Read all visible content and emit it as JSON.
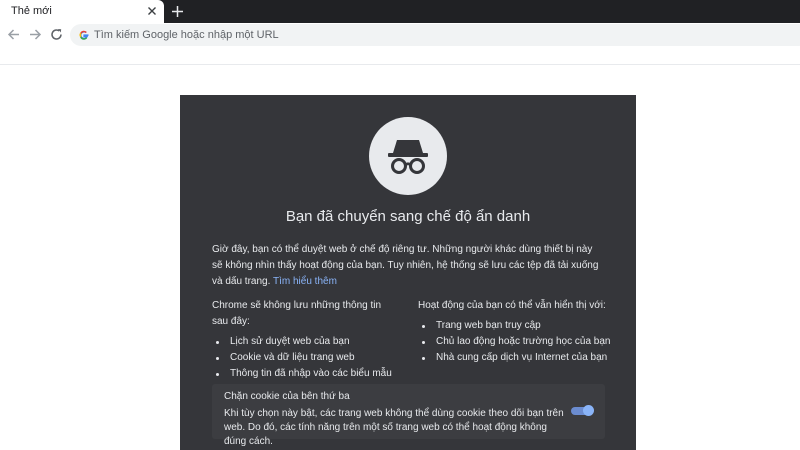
{
  "tab": {
    "title": "Thẻ mới"
  },
  "omnibox": {
    "placeholder": "Tìm kiếm Google hoặc nhập một URL"
  },
  "incognito": {
    "title": "Bạn đã chuyển sang chế độ ẩn danh",
    "description": "Giờ đây, bạn có thể duyệt web ở chế độ riêng tư. Những người khác dùng thiết bị này sẽ không nhìn thấy hoạt động của bạn. Tuy nhiên, hệ thống sẽ lưu các tệp đã tải xuống và dấu trang. ",
    "learn_more": "Tìm hiểu thêm",
    "not_saved": {
      "heading": "Chrome sẽ không lưu những thông tin sau đây:",
      "items": [
        "Lịch sử duyệt web của bạn",
        "Cookie và dữ liệu trang web",
        "Thông tin đã nhập vào các biểu mẫu"
      ]
    },
    "visible_to": {
      "heading": "Hoạt động của bạn có thể vẫn hiển thị với:",
      "items": [
        "Trang web bạn truy cập",
        "Chủ lao động hoặc trường học của bạn",
        "Nhà cung cấp dịch vụ Internet của bạn"
      ]
    },
    "cookie_card": {
      "title": "Chặn cookie của bên thứ ba",
      "description": "Khi tùy chọn này bật, các trang web không thể dùng cookie theo dõi bạn trên web. Do đó, các tính năng trên một số trang web có thể hoạt động không đúng cách.",
      "toggle_on": true
    }
  },
  "colors": {
    "ntp_background": "#35363a",
    "tab_strip": "#202124",
    "accent": "#8ab4f8"
  }
}
